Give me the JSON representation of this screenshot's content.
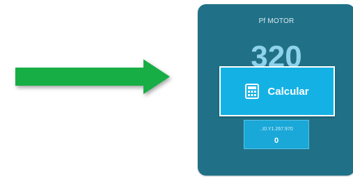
{
  "card": {
    "title": "Pf MOTOR",
    "value": "320",
    "calc_button_label": "Calcular",
    "sub_label": "..I0.Y1.267.970",
    "sub_value": "0"
  },
  "icons": {
    "arrow": "right-arrow-icon",
    "calculator": "calculator-icon"
  },
  "colors": {
    "arrow_green": "#17ae45",
    "card_background": "#207187",
    "button_blue": "#14b2e4",
    "value_text": "#8fd3ea"
  }
}
